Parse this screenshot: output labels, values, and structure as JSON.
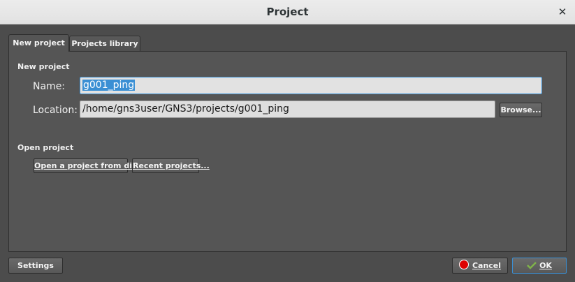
{
  "window": {
    "title": "Project",
    "close_glyph": "✕"
  },
  "tabs": [
    {
      "label": "New project",
      "active": true
    },
    {
      "label": "Projects library",
      "active": false
    }
  ],
  "new_project": {
    "section_label": "New project",
    "name_label": "Name:",
    "name_value": "g001_ping",
    "location_label": "Location:",
    "location_value": "/home/gns3user/GNS3/projects/g001_ping",
    "browse_label": "Browse..."
  },
  "open_project": {
    "section_label": "Open project",
    "open_from_disk_label": "Open a project from disk",
    "recent_label": "Recent projects..."
  },
  "footer": {
    "settings_label": "Settings",
    "cancel_label": "Cancel",
    "ok_label": "OK"
  },
  "colors": {
    "background": "#4c4c4c",
    "panel": "#555555",
    "selection": "#3a8fd4",
    "cancel_icon": "#dd0000",
    "ok_icon": "#7fb24a"
  },
  "icons": {
    "close": "close-icon",
    "cancel": "cancel-icon",
    "ok": "ok-check-icon"
  }
}
